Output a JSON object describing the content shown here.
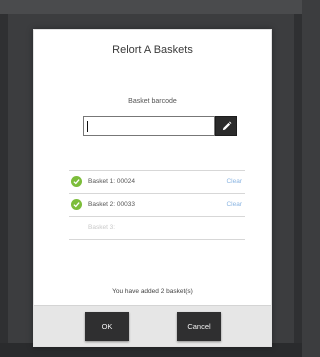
{
  "modal": {
    "title": "Relort A Baskets",
    "field_label": "Basket barcode",
    "input_value": "",
    "edit_icon": "pencil-icon",
    "accent": "#7cbd3a",
    "link_color": "#8ab4e2",
    "baskets": [
      {
        "label": "Basket 1:",
        "value": "00024",
        "action": "Clear"
      },
      {
        "label": "Basket 2:",
        "value": "00033",
        "action": "Clear"
      }
    ],
    "empty_slot": "Basket 3:",
    "added_message": "You have added 2 basket(s)",
    "ok_label": "OK",
    "cancel_label": "Cancel"
  }
}
